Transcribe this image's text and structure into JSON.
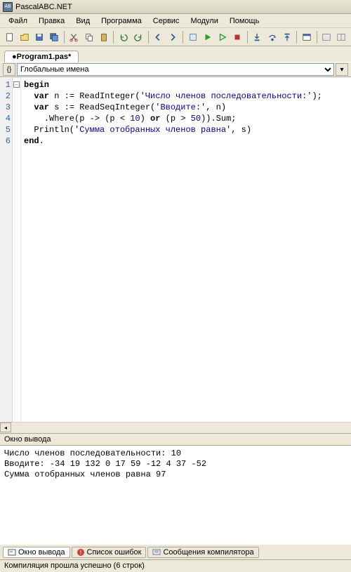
{
  "app_title": "PascalABC.NET",
  "menus": [
    "Файл",
    "Правка",
    "Вид",
    "Программа",
    "Сервис",
    "Модули",
    "Помощь"
  ],
  "tab_label": "●Program1.pas*",
  "scope_combo": "Глобальные имена",
  "code_lines": [
    "1",
    "2",
    "3",
    "4",
    "5",
    "6"
  ],
  "code": {
    "l1_kw": "begin",
    "l2a": "  ",
    "l2_kw1": "var",
    "l2b": " n := ReadInteger(",
    "l2_str": "'Число членов последовательности:'",
    "l2c": ");",
    "l3a": "  ",
    "l3_kw1": "var",
    "l3b": " s := ReadSeqInteger(",
    "l3_str": "'Вводите:'",
    "l3c": ", n)",
    "l4a": "    .Where(p -> (p < ",
    "l4_n1": "10",
    "l4b": ") ",
    "l4_kw1": "or",
    "l4c": " (p > ",
    "l4_n2": "50",
    "l4d": ")).Sum;",
    "l5a": "  Println(",
    "l5_str": "'Сумма отобранных членов равна'",
    "l5b": ", s)",
    "l6_kw": "end",
    "l6b": "."
  },
  "output_panel_title": "Окно вывода",
  "output_lines": [
    "Число членов последовательности: 10",
    "Вводите: -34 19 132 0 17 59 -12 4 37 -52",
    "Сумма отобранных членов равна 97"
  ],
  "bottom_tabs": {
    "output": "Окно вывода",
    "errors": "Список ошибок",
    "compiler": "Сообщения компилятора"
  },
  "status_text": "Компиляция прошла успешно (6 строк)"
}
